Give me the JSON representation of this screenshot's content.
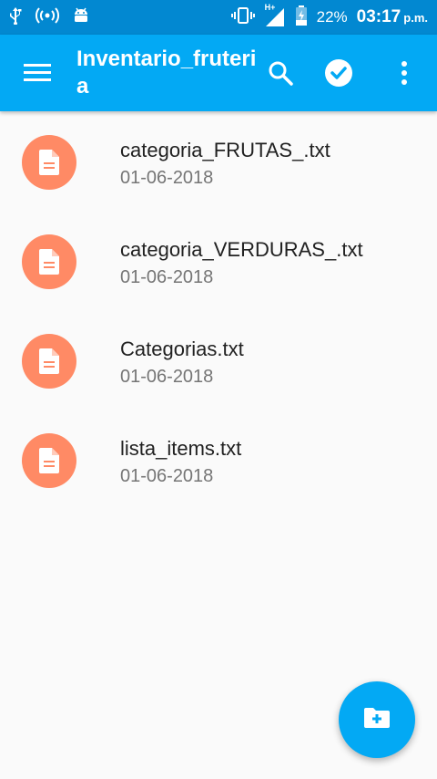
{
  "status_bar": {
    "network_type": "H+",
    "battery_percent": "22%",
    "time": "03:17",
    "ampm": "p.m.",
    "icons": [
      "usb-icon",
      "wireless-icon",
      "android-icon",
      "vibrate-icon",
      "signal-icon",
      "battery-charging-icon"
    ]
  },
  "app_bar": {
    "title": "Inventario_fruteria",
    "actions": [
      "menu-icon",
      "search-icon",
      "check-circle-icon",
      "more-vert-icon"
    ]
  },
  "files": [
    {
      "name": "categoria_FRUTAS_.txt",
      "date": "01-06-2018",
      "icon": "document-icon"
    },
    {
      "name": "categoria_VERDURAS_.txt",
      "date": "01-06-2018",
      "icon": "document-icon"
    },
    {
      "name": "Categorias.txt",
      "date": "01-06-2018",
      "icon": "document-icon"
    },
    {
      "name": "lista_items.txt",
      "date": "01-06-2018",
      "icon": "document-icon"
    }
  ],
  "fab": {
    "icon": "create-new-folder-icon"
  },
  "colors": {
    "status_bar": "#0288d1",
    "app_bar": "#03a9f4",
    "file_avatar": "#ff8a65",
    "background": "#fafafa"
  }
}
